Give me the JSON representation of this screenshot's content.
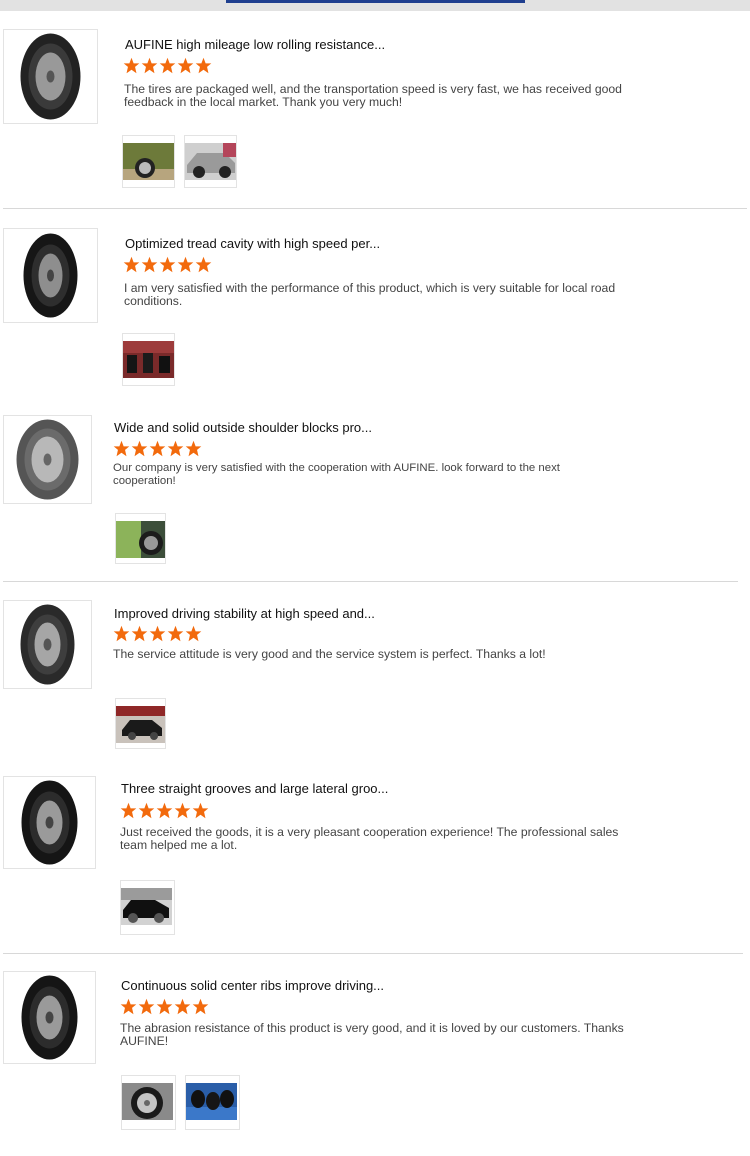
{
  "reviews": [
    {
      "title": "AUFINE high mileage low rolling resistance...",
      "rating": 5,
      "text": "The tires are packaged well, and the transportation speed is very fast, we has received good feedback in the local market. Thank you very much!",
      "photos": [
        "photo-green-car-wheel",
        "photo-silver-car"
      ]
    },
    {
      "title": "Optimized tread cavity with high speed per...",
      "rating": 5,
      "text": "I am very satisfied with the performance of this product, which is very suitable for local road conditions.",
      "photos": [
        "photo-tire-shop"
      ]
    },
    {
      "title": "Wide and solid outside shoulder blocks pro...",
      "rating": 5,
      "text": "Our company is very satisfied with the cooperation with AUFINE. look forward to the next cooperation!",
      "photos": [
        "photo-wheel-closeup"
      ]
    },
    {
      "title": "Improved driving stability at high speed and...",
      "rating": 5,
      "text": "The service attitude is very good and the service system is perfect. Thanks a lot!",
      "photos": [
        "photo-garage-car"
      ]
    },
    {
      "title": "Three straight grooves and large lateral groo...",
      "rating": 5,
      "text": "Just received the goods, it is a very pleasant cooperation experience! The professional sales team helped me a lot.",
      "photos": [
        "photo-black-car"
      ]
    },
    {
      "title": "Continuous solid center ribs improve driving...",
      "rating": 5,
      "text": "The abrasion resistance of this product is very good, and it is loved by our customers. Thanks AUFINE!",
      "photos": [
        "photo-steel-wheel",
        "photo-tire-stack"
      ]
    }
  ],
  "colors": {
    "star": "#f26a0d",
    "accent": "#1f3f8f",
    "divider": "#d8d8d8"
  }
}
